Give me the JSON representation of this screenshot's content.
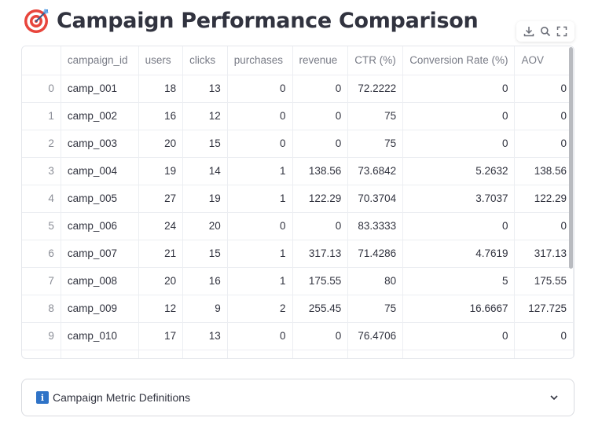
{
  "page": {
    "title": "Campaign Performance Comparison",
    "title_icon": "target-dart-icon"
  },
  "toolbar": {
    "buttons": [
      "download-icon",
      "search-icon",
      "fullscreen-icon"
    ]
  },
  "table": {
    "columns": [
      "",
      "campaign_id",
      "users",
      "clicks",
      "purchases",
      "revenue",
      "CTR (%)",
      "Conversion Rate (%)",
      "AOV"
    ],
    "rows": [
      [
        "0",
        "camp_001",
        "18",
        "13",
        "0",
        "0",
        "72.2222",
        "0",
        "0"
      ],
      [
        "1",
        "camp_002",
        "16",
        "12",
        "0",
        "0",
        "75",
        "0",
        "0"
      ],
      [
        "2",
        "camp_003",
        "20",
        "15",
        "0",
        "0",
        "75",
        "0",
        "0"
      ],
      [
        "3",
        "camp_004",
        "19",
        "14",
        "1",
        "138.56",
        "73.6842",
        "5.2632",
        "138.56"
      ],
      [
        "4",
        "camp_005",
        "27",
        "19",
        "1",
        "122.29",
        "70.3704",
        "3.7037",
        "122.29"
      ],
      [
        "5",
        "camp_006",
        "24",
        "20",
        "0",
        "0",
        "83.3333",
        "0",
        "0"
      ],
      [
        "6",
        "camp_007",
        "21",
        "15",
        "1",
        "317.13",
        "71.4286",
        "4.7619",
        "317.13"
      ],
      [
        "7",
        "camp_008",
        "20",
        "16",
        "1",
        "175.55",
        "80",
        "5",
        "175.55"
      ],
      [
        "8",
        "camp_009",
        "12",
        "9",
        "2",
        "255.45",
        "75",
        "16.6667",
        "127.725"
      ],
      [
        "9",
        "camp_010",
        "17",
        "13",
        "0",
        "0",
        "76.4706",
        "0",
        "0"
      ],
      [
        "",
        "",
        "",
        "",
        "",
        "",
        "",
        "",
        ""
      ]
    ]
  },
  "expander": {
    "icon": "info-icon",
    "icon_glyph": "i",
    "label": "Campaign Metric Definitions"
  },
  "colors": {
    "text": "#31333f",
    "header_text": "#787b86",
    "grid_line": "#eceef2",
    "info_blue": "#2f73c7",
    "title_icon_red": "#e8453c"
  }
}
